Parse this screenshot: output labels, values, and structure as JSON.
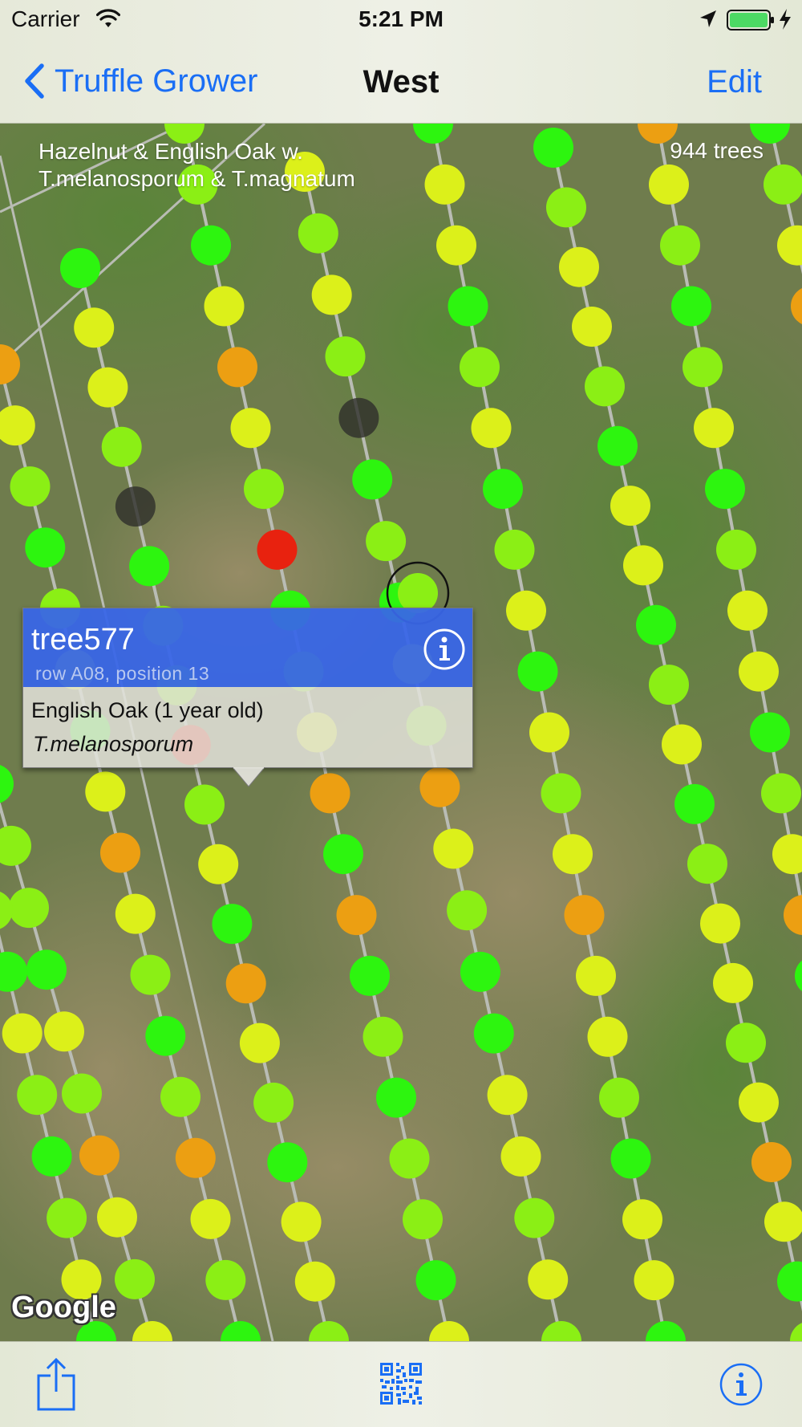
{
  "status_bar": {
    "carrier": "Carrier",
    "time": "5:21 PM",
    "icons": [
      "wifi-icon",
      "location-arrow-icon",
      "battery-icon",
      "charging-icon"
    ],
    "battery_color": "#4cd964"
  },
  "nav_bar": {
    "back_label": "Truffle Grower",
    "title": "West",
    "edit_label": "Edit",
    "tint_color": "#1a6ef5"
  },
  "map": {
    "caption_line1": "Hazelnut & English Oak w.",
    "caption_line2": "T.melanosporum & T.magnatum",
    "tree_count": "944 trees",
    "attribution": "Google",
    "legend_colors": {
      "green": "#2df50f",
      "yellow_green": "#8bef15",
      "yellow": "#dcf01a",
      "orange": "#ec9f12",
      "red": "#e8220f",
      "inactive": "#2e2e2a"
    }
  },
  "callout": {
    "title": "tree577",
    "subtitle": "row A08, position 13",
    "species_line": "English Oak (1 year old)",
    "truffle_line": "T.melanosporum",
    "header_color": "#3866e8"
  },
  "toolbar": {
    "icons": [
      "share-icon",
      "qr-code-icon",
      "info-icon"
    ]
  }
}
